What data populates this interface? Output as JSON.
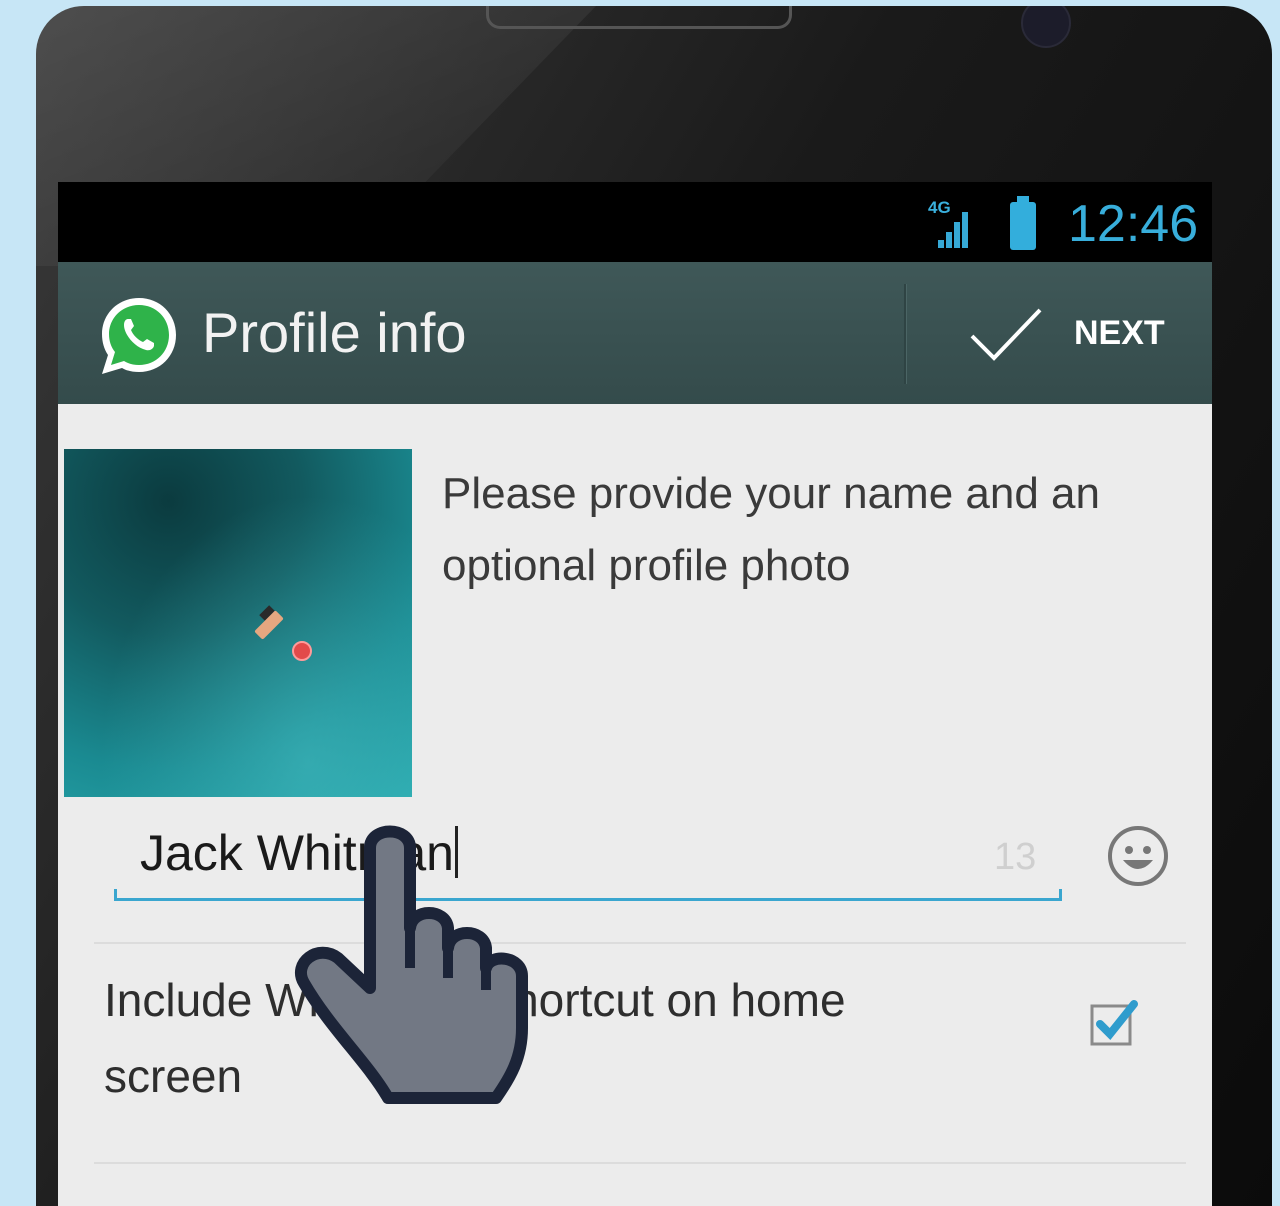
{
  "status_bar": {
    "network": "4G",
    "time": "12:46"
  },
  "action_bar": {
    "logo_icon": "whatsapp-logo-icon",
    "title": "Profile info",
    "next_label": "NEXT"
  },
  "profile": {
    "prompt": "Please provide your name and an optional profile photo",
    "name_value": "Jack Whitman",
    "char_count": "13",
    "emoji_icon": "smiley-icon"
  },
  "shortcut": {
    "label": "Include WhatsApp shortcut on home screen",
    "checked": true
  },
  "colors": {
    "accent": "#3aa6cf",
    "action_bar": "#3d5555",
    "background": "#c7e6f6"
  }
}
